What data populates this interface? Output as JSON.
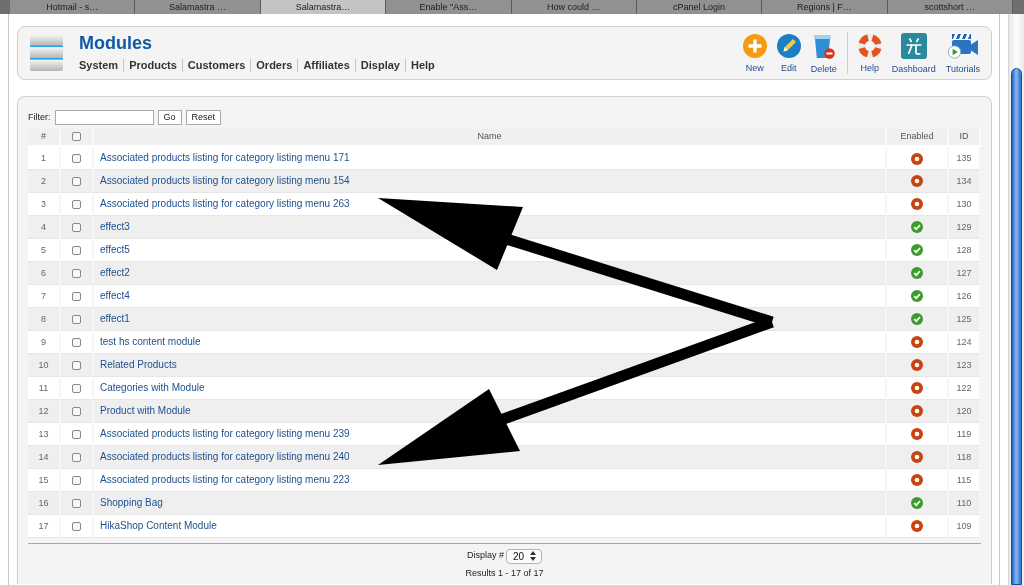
{
  "browser_tabs": [
    {
      "label": "Hotmail - s…",
      "selected": false
    },
    {
      "label": "Salamastra …",
      "selected": false
    },
    {
      "label": "Salamastra…",
      "selected": true
    },
    {
      "label": "Enable \"Ass…",
      "selected": false
    },
    {
      "label": "How could …",
      "selected": false
    },
    {
      "label": "cPanel Login",
      "selected": false
    },
    {
      "label": "Regions | F…",
      "selected": false
    },
    {
      "label": "scottshort …",
      "selected": false
    }
  ],
  "header": {
    "title": "Modules",
    "menu": [
      "System",
      "Products",
      "Customers",
      "Orders",
      "Affiliates",
      "Display",
      "Help"
    ],
    "toolbar_groups": [
      {
        "buttons": [
          {
            "kind": "new",
            "label": "New"
          },
          {
            "kind": "edit",
            "label": "Edit"
          },
          {
            "kind": "delete",
            "label": "Delete"
          }
        ]
      },
      {
        "buttons": [
          {
            "kind": "help",
            "label": "Help"
          },
          {
            "kind": "dashboard",
            "label": "Dashboard"
          },
          {
            "kind": "tutorials",
            "label": "Tutorials"
          }
        ]
      }
    ]
  },
  "filter": {
    "label": "Filter:",
    "buttons": [
      "Go",
      "Reset"
    ]
  },
  "table": {
    "columns": [
      {
        "kind": "text",
        "label": "#"
      },
      {
        "kind": "checkbox",
        "checked": false
      },
      {
        "kind": "text",
        "label": "Name"
      },
      {
        "kind": "text",
        "label": "Enabled"
      },
      {
        "kind": "text",
        "label": "ID"
      }
    ],
    "rows": [
      {
        "number": "1",
        "checked": false,
        "name": "Associated products listing for category listing menu 171",
        "enabled": false,
        "id": "135"
      },
      {
        "number": "2",
        "checked": false,
        "name": "Associated products listing for category listing menu 154",
        "enabled": false,
        "id": "134"
      },
      {
        "number": "3",
        "checked": false,
        "name": "Associated products listing for category listing menu 263",
        "enabled": false,
        "id": "130"
      },
      {
        "number": "4",
        "checked": false,
        "name": "effect3",
        "enabled": true,
        "id": "129"
      },
      {
        "number": "5",
        "checked": false,
        "name": "effect5",
        "enabled": true,
        "id": "128"
      },
      {
        "number": "6",
        "checked": false,
        "name": "effect2",
        "enabled": true,
        "id": "127"
      },
      {
        "number": "7",
        "checked": false,
        "name": "effect4",
        "enabled": true,
        "id": "126"
      },
      {
        "number": "8",
        "checked": false,
        "name": "effect1",
        "enabled": true,
        "id": "125"
      },
      {
        "number": "9",
        "checked": false,
        "name": "test hs content module",
        "enabled": false,
        "id": "124"
      },
      {
        "number": "10",
        "checked": false,
        "name": "Related Products",
        "enabled": false,
        "id": "123"
      },
      {
        "number": "11",
        "checked": false,
        "name": "Categories with Module",
        "enabled": false,
        "id": "122"
      },
      {
        "number": "12",
        "checked": false,
        "name": "Product with Module",
        "enabled": false,
        "id": "120"
      },
      {
        "number": "13",
        "checked": false,
        "name": "Associated products listing for category listing menu 239",
        "enabled": false,
        "id": "119"
      },
      {
        "number": "14",
        "checked": false,
        "name": "Associated products listing for category listing menu 240",
        "enabled": false,
        "id": "118"
      },
      {
        "number": "15",
        "checked": false,
        "name": "Associated products listing for category listing menu 223",
        "enabled": false,
        "id": "115"
      },
      {
        "number": "16",
        "checked": false,
        "name": "Shopping Bag",
        "enabled": true,
        "id": "110"
      },
      {
        "number": "17",
        "checked": false,
        "name": "HikaShop Content Module",
        "enabled": false,
        "id": "109"
      }
    ]
  },
  "footer": {
    "display_label": "Display #",
    "display_value": "20",
    "results": "Results 1 - 17 of 17"
  }
}
